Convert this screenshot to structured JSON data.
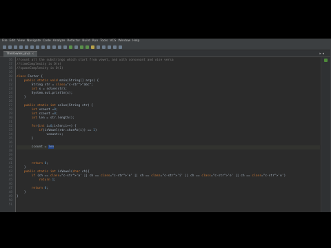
{
  "menu": [
    "File",
    "Edit",
    "View",
    "Navigate",
    "Code",
    "Analyze",
    "Refactor",
    "Build",
    "Run",
    "Tools",
    "VCS",
    "Window",
    "Help"
  ],
  "tab": {
    "label": "TheVowles.java",
    "close": "×"
  },
  "tab_arrows": "▸ ◂",
  "code_lines": [
    {
      "num": "16",
      "text": "//count all the substrings which start from vowel, and with consonant and vise versa",
      "cls": "c-com"
    },
    {
      "num": "17",
      "text": "//timeComplexity is O(n)",
      "cls": "c-com"
    },
    {
      "num": "18",
      "text": "//spaceComplexity is O(1)",
      "cls": "c-com"
    },
    {
      "num": "19",
      "text": "",
      "cls": ""
    },
    {
      "num": "20",
      "text": "class Factor {",
      "cls": "kwclass"
    },
    {
      "num": "21",
      "text": "    public static void main(String[] args) {",
      "cls": "main"
    },
    {
      "num": "22",
      "text": "        String str = \"abc\";",
      "cls": "str"
    },
    {
      "num": "23",
      "text": "        int x = solve(str);",
      "cls": "intsolve"
    },
    {
      "num": "24",
      "text": "        System.out.println(x);",
      "cls": "plain"
    },
    {
      "num": "25",
      "text": "    }",
      "cls": "plain"
    },
    {
      "num": "26",
      "text": "",
      "cls": ""
    },
    {
      "num": "27",
      "text": "    public static int solve(String str) {",
      "cls": "solve"
    },
    {
      "num": "28",
      "text": "        int vcount =0;",
      "cls": "intnum"
    },
    {
      "num": "29",
      "text": "        int ccount =0;",
      "cls": "intnum"
    },
    {
      "num": "30",
      "text": "        int len = str.length();",
      "cls": "intlen"
    },
    {
      "num": "31",
      "text": "",
      "cls": ""
    },
    {
      "num": "32",
      "text": "        for(int i=0;i<len;i++) {",
      "cls": "for"
    },
    {
      "num": "33",
      "text": "            if(isVowel(str.charAt(i)) == 1)",
      "cls": "if1"
    },
    {
      "num": "34",
      "text": "                vcount++;",
      "cls": "plain"
    },
    {
      "num": "35",
      "text": "        }",
      "cls": "plain"
    },
    {
      "num": "36",
      "text": "",
      "cls": ""
    },
    {
      "num": "37",
      "text": "        ccount = len",
      "cls": "cur"
    },
    {
      "num": "38",
      "text": "",
      "cls": ""
    },
    {
      "num": "39",
      "text": "",
      "cls": ""
    },
    {
      "num": "40",
      "text": "",
      "cls": ""
    },
    {
      "num": "41",
      "text": "        return 0;",
      "cls": "ret"
    },
    {
      "num": "42",
      "text": "    }",
      "cls": "plain"
    },
    {
      "num": "43",
      "text": "    public static int isVowel(char ch){",
      "cls": "isvowel"
    },
    {
      "num": "44",
      "text": "        if (ch == 'a' || ch == 'e' || ch == 'i' || ch == 'o' || ch == 'u')",
      "cls": "if2"
    },
    {
      "num": "45",
      "text": "            return 1;",
      "cls": "ret"
    },
    {
      "num": "46",
      "text": "",
      "cls": ""
    },
    {
      "num": "47",
      "text": "        return 0;",
      "cls": "ret"
    },
    {
      "num": "48",
      "text": "    }",
      "cls": "plain"
    },
    {
      "num": "49",
      "text": "}",
      "cls": "plain"
    },
    {
      "num": "50",
      "text": "",
      "cls": ""
    },
    {
      "num": "51",
      "text": "",
      "cls": ""
    }
  ],
  "colors": {
    "keyword": "#cc7832",
    "string": "#6a8759",
    "number": "#6897bb",
    "comment": "#808080",
    "method": "#ffc66d",
    "text": "#a9b7c6",
    "highlight": "#214283"
  }
}
